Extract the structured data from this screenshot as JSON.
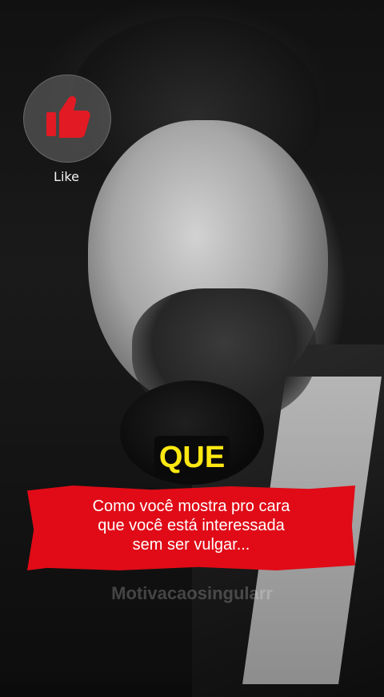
{
  "overlay": {
    "like_label": "Like",
    "highlight_word": "QUE",
    "caption_lines": [
      "Como você mostra pro cara",
      "que você está interessada",
      "sem ser vulgar..."
    ],
    "watermark": "Motivacaosingularr"
  },
  "icons": {
    "like": "thumbs-up-icon"
  },
  "colors": {
    "caption_background": "#e00b17",
    "highlight_text": "#ffe812",
    "highlight_background": "#0a0a0a",
    "like_icon": "#e21a24"
  }
}
